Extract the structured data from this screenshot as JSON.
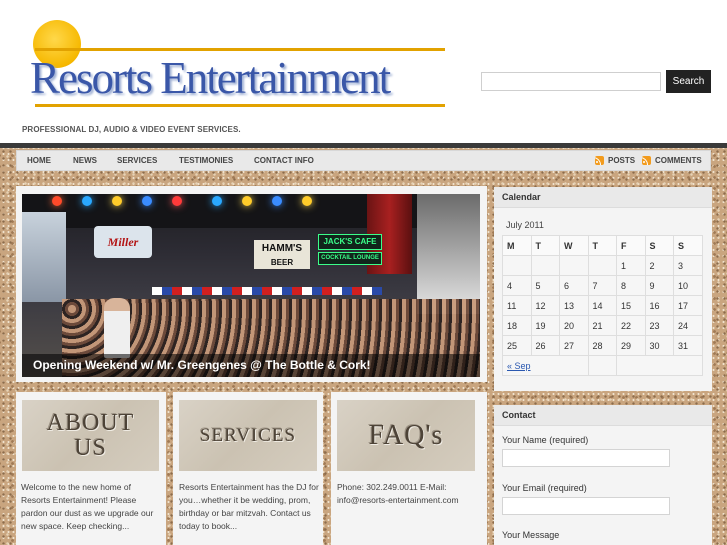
{
  "site": {
    "logo_text": "Resorts Entertainment",
    "tagline": "PROFESSIONAL DJ, AUDIO & VIDEO EVENT SERVICES.",
    "brand_color": "#3a57a8",
    "sun_color": "#f6b800"
  },
  "search": {
    "placeholder": "",
    "value": "",
    "button_label": "Search"
  },
  "nav": {
    "items": [
      "HOME",
      "NEWS",
      "SERVICES",
      "TESTIMONIES",
      "CONTACT INFO"
    ],
    "feeds": [
      {
        "label": "POSTS",
        "icon": "rss-icon"
      },
      {
        "label": "COMMENTS",
        "icon": "rss-icon"
      }
    ]
  },
  "feature": {
    "caption": "Opening Weekend w/ Mr. Greengenes @ The Bottle & Cork!",
    "signs": [
      "Miller",
      "HAMM'S",
      "BEER",
      "JACK'S CAFE",
      "COCKTAIL LOUNGE"
    ]
  },
  "promos": [
    {
      "image_text_line1": "ABOUT",
      "image_text_line2": "US",
      "text": "Welcome to the new home of Resorts Entertainment!  Please pardon our dust as we upgrade our new space.  Keep checking..."
    },
    {
      "image_text_line1": "SERVICES",
      "image_text_line2": "",
      "text": "Resorts Entertainment has the DJ for you…whether it be wedding, prom, birthday or bar mitzvah.  Contact us today to book..."
    },
    {
      "image_text_line1": "FAQ's",
      "image_text_line2": "",
      "text": "Phone: 302.249.0011 E-Mail: info@resorts-entertainment.com"
    }
  ],
  "calendar": {
    "title": "Calendar",
    "caption": "July 2011",
    "weekdays": [
      "M",
      "T",
      "W",
      "T",
      "F",
      "S",
      "S"
    ],
    "weeks": [
      [
        "",
        "",
        "",
        "",
        "1",
        "2",
        "3"
      ],
      [
        "4",
        "5",
        "6",
        "7",
        "8",
        "9",
        "10"
      ],
      [
        "11",
        "12",
        "13",
        "14",
        "15",
        "16",
        "17"
      ],
      [
        "18",
        "19",
        "20",
        "21",
        "22",
        "23",
        "24"
      ],
      [
        "25",
        "26",
        "27",
        "28",
        "29",
        "30",
        "31"
      ]
    ],
    "prev_link": "« Sep"
  },
  "contact": {
    "title": "Contact",
    "name_label": "Your Name (required)",
    "email_label": "Your Email (required)",
    "message_label": "Your Message"
  }
}
